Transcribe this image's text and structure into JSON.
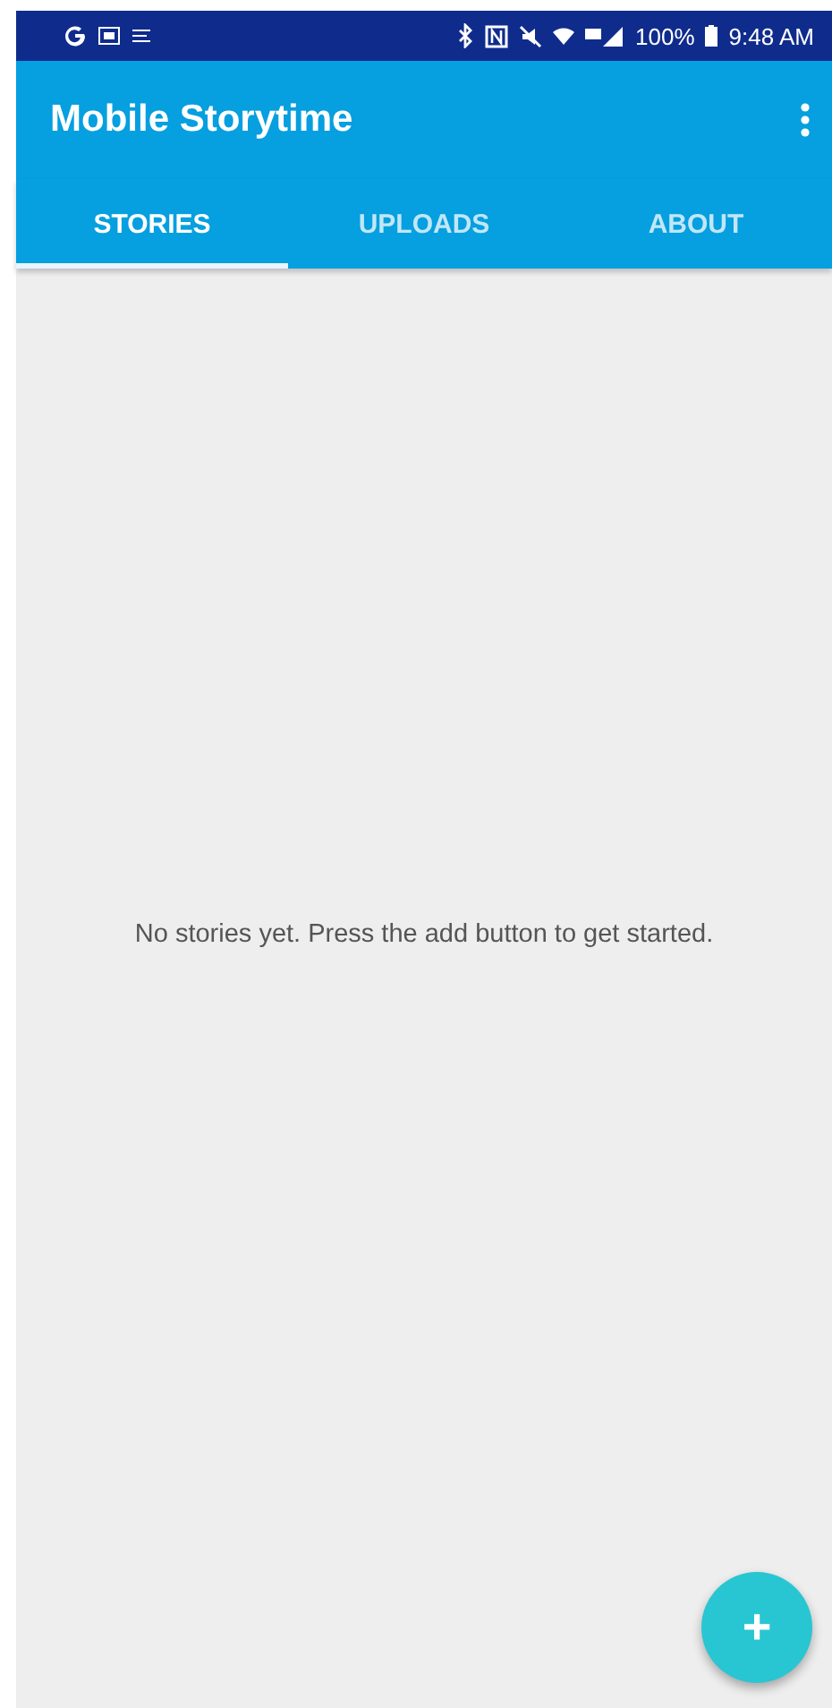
{
  "status_bar": {
    "battery": "100%",
    "time": "9:48 AM"
  },
  "app_bar": {
    "title": "Mobile Storytime"
  },
  "tabs": [
    {
      "label": "STORIES",
      "selected": true
    },
    {
      "label": "UPLOADS",
      "selected": false
    },
    {
      "label": "ABOUT",
      "selected": false
    }
  ],
  "empty_message": "No stories yet. Press the add button to get started.",
  "fab": {
    "label": "+"
  }
}
